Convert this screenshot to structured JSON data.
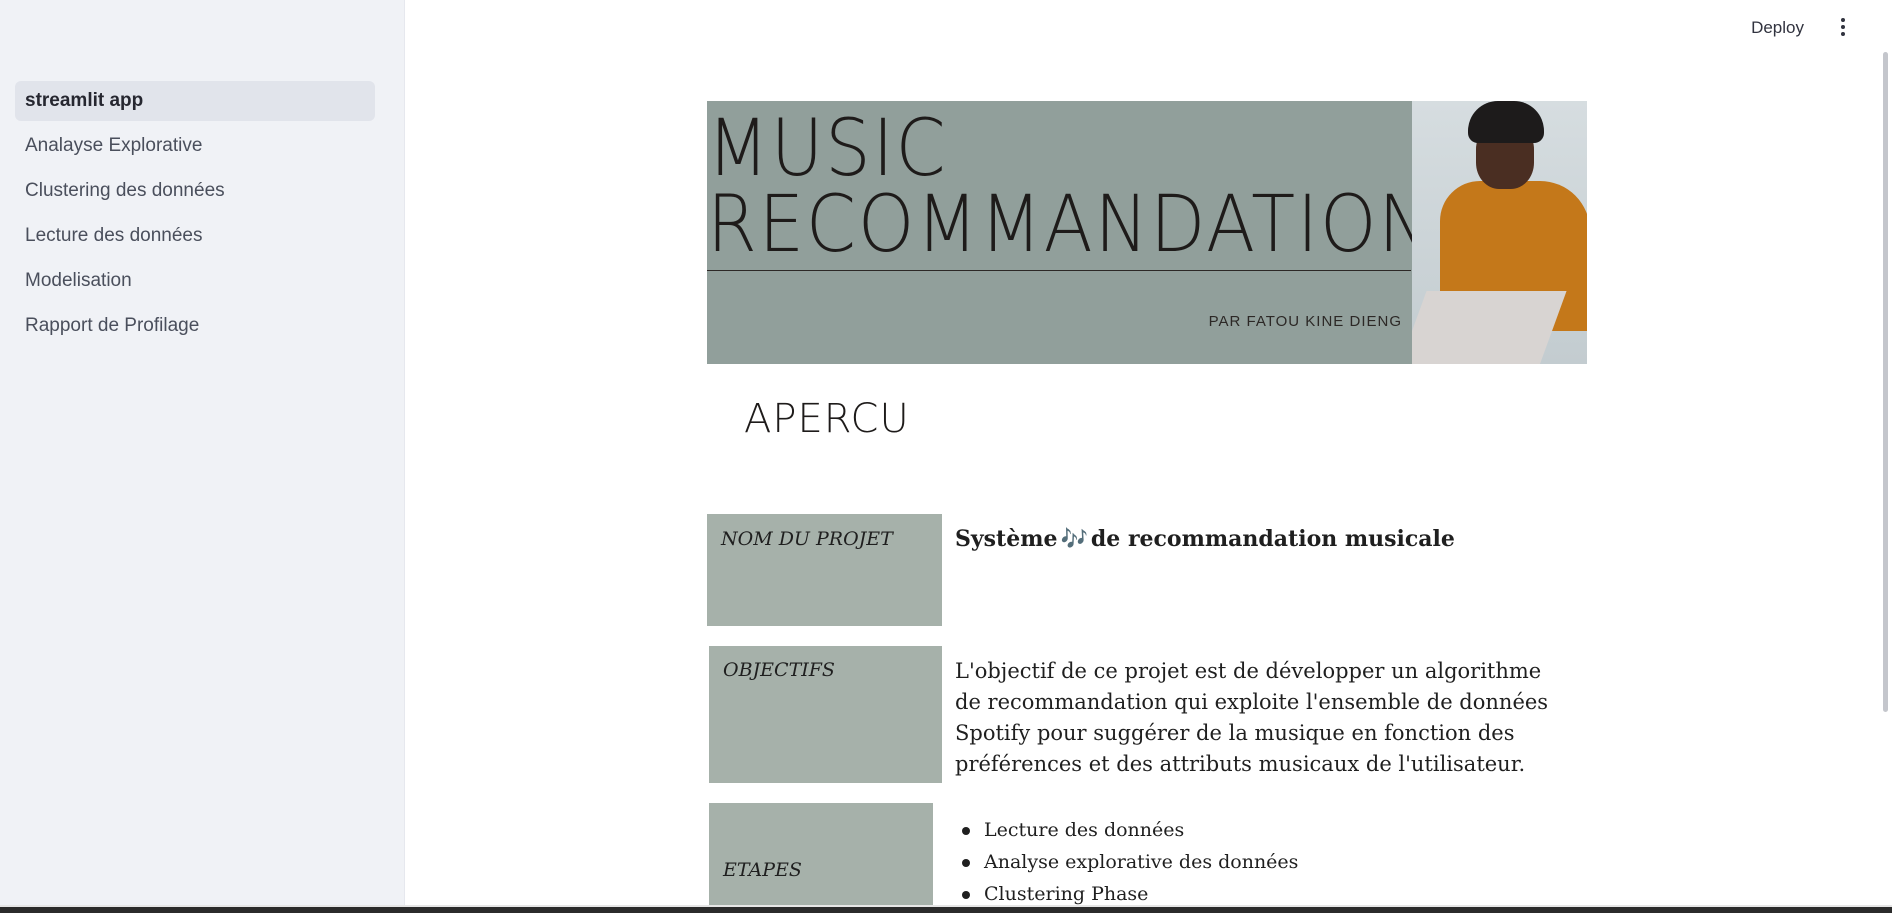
{
  "sidebar": {
    "items": [
      {
        "label": "streamlit app",
        "active": true
      },
      {
        "label": "Analayse Explorative",
        "active": false
      },
      {
        "label": "Clustering des données",
        "active": false
      },
      {
        "label": "Lecture des données",
        "active": false
      },
      {
        "label": "Modelisation",
        "active": false
      },
      {
        "label": "Rapport de Profilage",
        "active": false
      }
    ]
  },
  "header": {
    "deploy_label": "Deploy",
    "menu_icon": "kebab-menu-icon"
  },
  "banner": {
    "title_line1": "MUSIC",
    "title_line2": "RECOMMANDATION",
    "author": "PAR FATOU KINE DIENG"
  },
  "main": {
    "apercu": "APERCU",
    "rows": {
      "name_label": "NOM DU PROJET",
      "name_value_pre": "Système",
      "name_value_icon": "🎶",
      "name_value_post": "de recommandation musicale",
      "objectives_label": "OBJECTIFS",
      "objectives_value": "L'objectif de ce projet est de développer un algorithme de recommandation qui exploite l'ensemble de données Spotify pour suggérer de la musique en fonction des préférences et des attributs musicaux de l'utilisateur.",
      "steps_label": "ETAPES",
      "steps": [
        " Lecture des données",
        "Analyse explorative des données",
        "Clustering Phase"
      ]
    }
  },
  "colors": {
    "sidebar_bg": "#f0f2f6",
    "banner_bg": "#919f9b",
    "label_bg": "#a6b1aa"
  }
}
